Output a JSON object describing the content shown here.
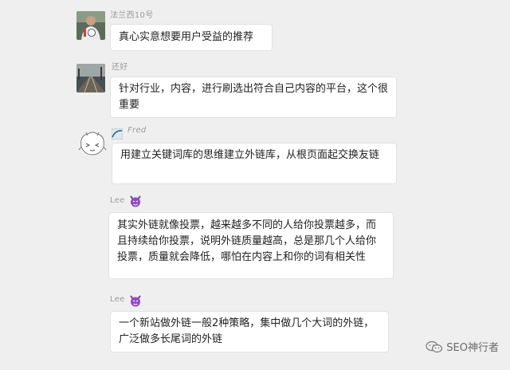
{
  "messages": [
    {
      "name": "法兰西10号",
      "text": "真心实意想要用户受益的推荐",
      "avatar_icon": "footballer-photo-icon"
    },
    {
      "name": "还好",
      "text": "针对行业，内容，进行刷选出符合自己内容的平台，这个很重要",
      "avatar_icon": "railway-track-photo-icon"
    },
    {
      "name": "Fred",
      "text": "用建立关键词库的思维建立外链库，从根页面起交换友链",
      "avatar_icon": "doodle-face-icon"
    },
    {
      "name": "Lee",
      "text": "其实外链就像投票，越来越多不同的人给你投票越多，而且持续给你投票，说明外链质量越高，总是那几个人给你投票，质量就会降低，哪怕在内容上和你的词有相关性",
      "badge_icon": "purple-devil-emoji-icon"
    },
    {
      "name": "Lee",
      "text": "一个新站做外链一般2种策略，集中做几个大词的外链，广泛做多长尾词的外链",
      "badge_icon": "purple-devil-emoji-icon"
    }
  ],
  "watermark": {
    "text": "SEO神行者",
    "icon": "wechat-icon"
  }
}
